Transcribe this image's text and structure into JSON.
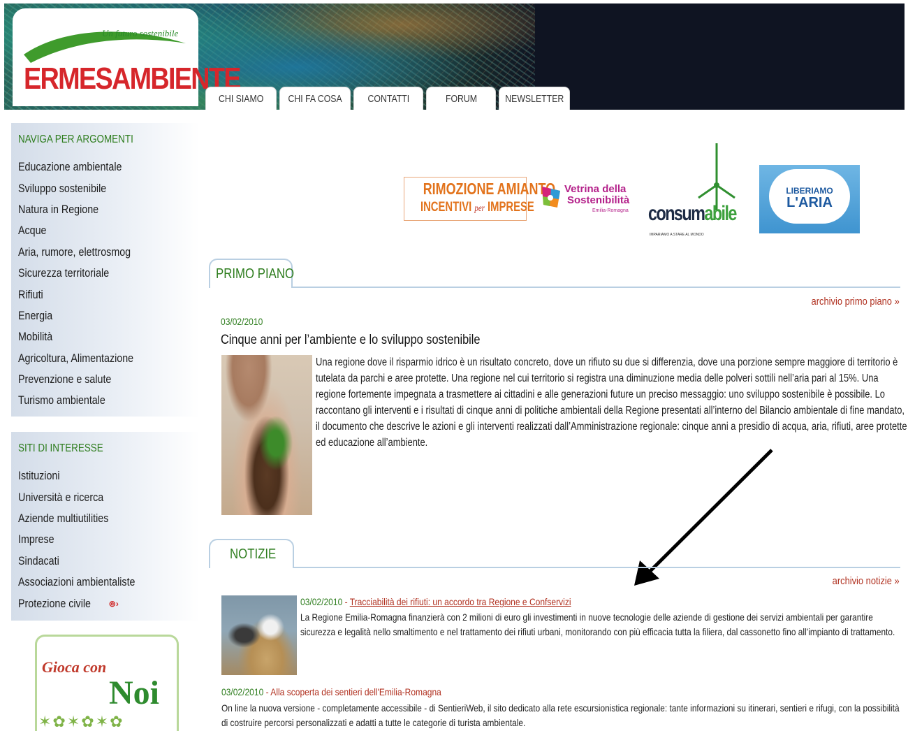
{
  "logo": {
    "tagline": "Un futuro sostenibile",
    "name_part1": "ERMES",
    "name_part2": "AMBIENTE",
    "brand_red": "#d6262b",
    "brand_green": "#2e8b2e"
  },
  "nav": {
    "tabs": [
      "CHI SIAMO",
      "CHI FA COSA",
      "CONTATTI",
      "FORUM",
      "NEWSLETTER"
    ]
  },
  "sidebar": {
    "topics_title": "NAVIGA PER ARGOMENTI",
    "topics": [
      "Educazione ambientale",
      "Sviluppo sostenibile",
      "Natura in Regione",
      "Acque",
      "Aria, rumore, elettrosmog",
      "Sicurezza territoriale",
      "Rifiuti",
      "Energia",
      "Mobilità",
      "Agricoltura, Alimentazione",
      "Prevenzione e salute",
      "Turismo ambientale"
    ],
    "sites_title": "SITI DI INTERESSE",
    "sites": [
      "Istituzioni",
      "Università e ricerca",
      "Aziende multiutilities",
      "Imprese",
      "Sindacati",
      "Associazioni ambientaliste",
      "Protezione civile"
    ],
    "external_icon": "external-link-icon"
  },
  "promo": {
    "gioca_line1": "Gioca con",
    "gioca_line2": "Noi"
  },
  "banners": {
    "amianto_line1": "RIMOZIONE AMIANTO",
    "amianto_incentivi": "INCENTIVI",
    "amianto_per": "per",
    "amianto_imprese": "IMPRESE",
    "vetrina_line1": "Vetrina della",
    "vetrina_line2": "Sostenibilità",
    "vetrina_line3": "Emilia-Romagna",
    "consum_part1": "consum",
    "consum_part2": "abile",
    "consum_sub": "IMPARIAMO A STARE AL MONDO",
    "aria_line1": "LIBERIAMO",
    "aria_line2": "L'ARIA"
  },
  "primo_piano": {
    "section_title": "PRIMO PIANO",
    "archive_link": "archivio primo piano »",
    "date": "03/02/2010",
    "title": "Cinque anni per l’ambiente e lo sviluppo sostenibile",
    "text": "Una regione dove il risparmio idrico è un risultato concreto, dove un rifiuto su due si differenzia, dove una porzione sempre maggiore di territorio è tutelata da parchi e aree protette. Una regione nel cui territorio si registra una diminuzione media delle polveri sottili nell’aria pari al 15%. Una regione fortemente impegnata a trasmettere ai cittadini e alle generazioni future un preciso messaggio: uno sviluppo sostenibile è possibile. Lo raccontano gli interventi e i risultati di cinque anni di politiche ambientali della Regione presentati all’interno del Bilancio ambientale di fine mandato, il documento che descrive le azioni e gli interventi realizzati dall’Amministrazione regionale: cinque anni a presidio di acqua, aria, rifiuti, aree protette ed educazione all’ambiente."
  },
  "notizie": {
    "section_title": "NOTIZIE",
    "archive_link": "archivio notizie »",
    "items": [
      {
        "date": "03/02/2010",
        "separator": " - ",
        "title": "Tracciabilità dei rifiuti: un accordo tra Regione e Confservizi",
        "body": "La Regione Emilia-Romagna finanzierà con 2 milioni di euro gli investimenti in nuove tecnologie delle aziende di gestione dei servizi ambientali per garantire sicurezza e legalità nello smaltimento e nel trattamento dei rifiuti urbani, monitorando con più efficacia tutta la filiera, dal cassonetto fino all’impianto di trattamento."
      },
      {
        "date": "03/02/2010",
        "separator": " - ",
        "title": "Alla scoperta dei sentieri dell'Emilia-Romagna",
        "body": "On line la nuova versione - completamente accessibile - di SentieriWeb, il sito dedicato alla rete escursionistica regionale: tante informazioni su itinerari, sentieri e rifugi, con la possibilità di costruire percorsi personalizzati e adatti a tutte le categorie di turista ambientale."
      }
    ]
  },
  "colors": {
    "section_green": "#2e7d1e",
    "link_red": "#b0301f",
    "tab_border": "#b9cfe2",
    "sidebar_bg": "#d4dde9"
  }
}
